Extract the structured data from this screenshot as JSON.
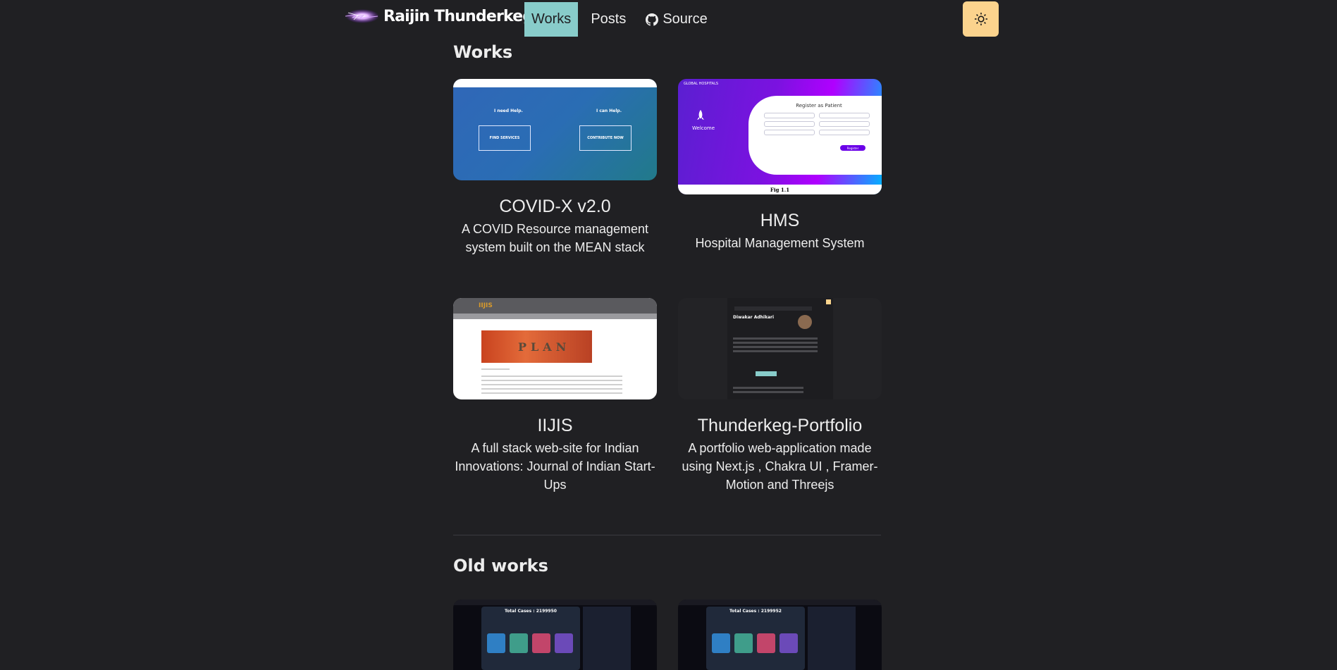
{
  "nav": {
    "brand": "Raijin Thunderkeg",
    "links": [
      {
        "label": "Works",
        "active": true
      },
      {
        "label": "Posts",
        "active": false
      },
      {
        "label": "Source",
        "active": false,
        "icon": "github-icon"
      }
    ],
    "theme_toggle_icon": "sun-icon",
    "theme_toggle_color": "#fbd38d",
    "accent": "#88ccca"
  },
  "sections": {
    "works": {
      "title": "Works",
      "cards": [
        {
          "title": "COVID-X v2.0",
          "desc": "A COVID Resource management system built on the MEAN stack",
          "thumb": {
            "left_label": "I need Help.",
            "right_label": "I can Help.",
            "left_button": "FIND SERVICES",
            "right_button": "CONTRIBUTE NOW"
          }
        },
        {
          "title": "HMS",
          "desc": "Hospital Management System",
          "thumb": {
            "brand": "GLOBAL HOSPITALS",
            "welcome": "Welcome",
            "heading": "Register as Patient",
            "caption": "Fig 1.1",
            "submit": "Register"
          }
        },
        {
          "title": "IIJIS",
          "desc": "A full stack web-site for Indian Innovations: Journal of Indian Start-Ups",
          "thumb": {
            "logo": "IIJIS",
            "tile_word": "PLAN"
          }
        },
        {
          "title": "Thunderkeg-Portfolio",
          "desc": "A portfolio web-application made using Next.js , Chakra UI , Framer-Motion and Threejs",
          "thumb": {
            "name": "Diwakar Adhikari"
          }
        }
      ]
    },
    "old_works": {
      "title": "Old works",
      "cards": [
        {
          "thumb": {
            "heading": "Total Cases : 2199950"
          }
        },
        {
          "thumb": {
            "heading": "Total Cases : 2199952"
          }
        }
      ]
    }
  }
}
